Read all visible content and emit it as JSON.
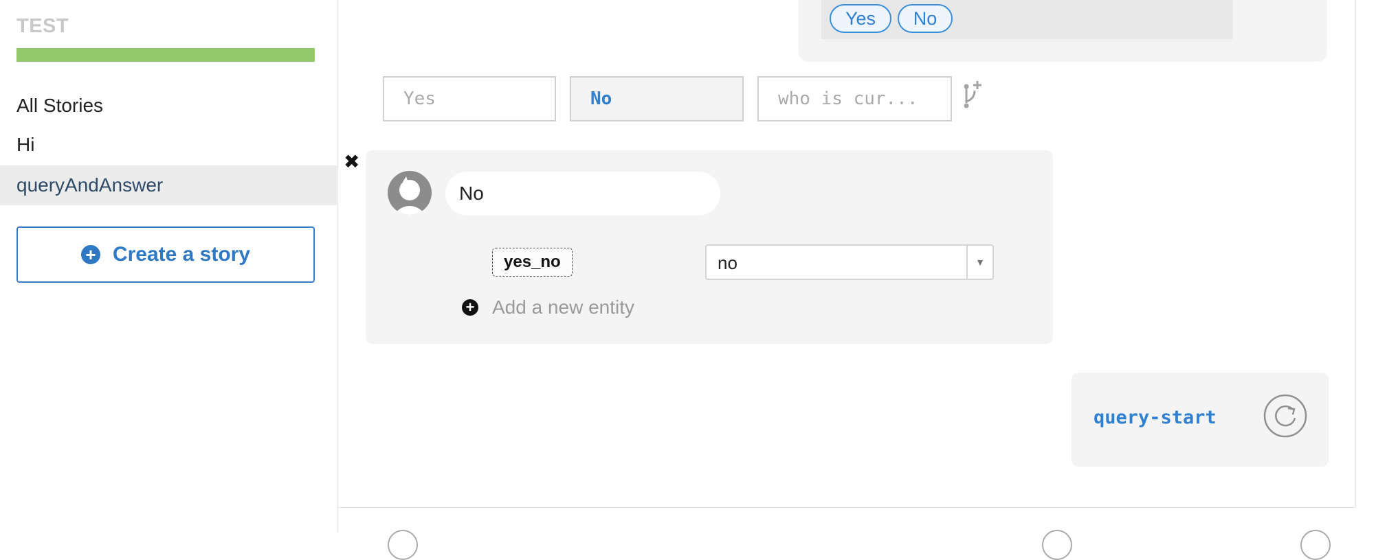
{
  "sidebar": {
    "project_title": "TEST",
    "progress_percent": 100,
    "progress_color": "#92c96a",
    "section_label": "All Stories",
    "stories": [
      {
        "label": "Hi",
        "active": false
      },
      {
        "label": "queryAndAnswer",
        "active": true
      }
    ],
    "create_story_label": "Create a story",
    "create_story_icon": "plus-circle-icon"
  },
  "bot_message": {
    "buttons": [
      "Yes",
      "No"
    ]
  },
  "options": {
    "items": [
      {
        "label": "Yes",
        "selected": false
      },
      {
        "label": "No",
        "selected": true
      },
      {
        "label": "who is cur...",
        "selected": false
      }
    ],
    "branch_icon": "branch-add-icon"
  },
  "user_message": {
    "text": "No",
    "avatar_icon": "user-avatar-icon",
    "remove_icon": "close-icon",
    "entity": {
      "name": "yes_no",
      "value": "no"
    },
    "add_entity_label": "Add a new entity"
  },
  "action": {
    "name": "query-start",
    "icon": "redo-icon"
  },
  "colors": {
    "accent": "#2f80d0",
    "card_bg": "#f4f4f4"
  }
}
